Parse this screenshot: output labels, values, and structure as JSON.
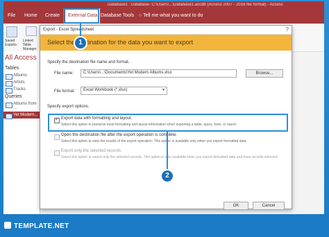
{
  "titlebar": {
    "text": "Database1 : Database- C:\\Users\\...\\Database1.accdb (Access 2007 - 2016 file format) - Access"
  },
  "ribbon": {
    "tabs": [
      "File",
      "Home",
      "Create",
      "External Data",
      "Database Tools"
    ],
    "tell_me": "Tell me what you want to do",
    "groups": [
      "Saved Exports",
      "Linked Table Manager"
    ]
  },
  "nav": {
    "header": "All Access",
    "tables_label": "Tables",
    "tables": [
      "Albums",
      "Artists",
      "Tracks"
    ],
    "queries_label": "Queries",
    "queries": [
      "Albums from ...",
      "Yet Modern..."
    ]
  },
  "dialog": {
    "title": "Export - Excel Spreadsheet",
    "banner": "Select the destination for the data you want to export",
    "spec_text": "Specify the destination file name and format.",
    "file_name_label": "File name:",
    "file_name_value": "C:\\Users\\...\\Documents\\Yet Modern Albums.xlsx",
    "browse": "Browse...",
    "file_format_label": "File format:",
    "file_format_value": "Excel Workbook (*.xlsx)",
    "options_head": "Specify export options.",
    "options": [
      {
        "label": "Export data with formatting and layout.",
        "desc": "Select this option to preserve most formatting and layout information when exporting a table, query, form, or report.",
        "checked": true,
        "disabled": false
      },
      {
        "label": "Open the destination file after the export operation is complete.",
        "desc": "Select this option to view the results of the export operation. This option is available only when you export formatted data.",
        "checked": false,
        "disabled": true
      },
      {
        "label": "Export only the selected records.",
        "desc": "Select this option to export only the selected records. This option is only available when you export formatted data and have records selected.",
        "checked": false,
        "disabled": true
      }
    ],
    "ok": "OK",
    "cancel": "Cancel"
  },
  "callouts": [
    "1",
    "2"
  ],
  "brand": "TEMPLATE.NET",
  "colors": {
    "access_red": "#a4373a",
    "banner": "#f3b43c",
    "highlight": "#2a8fd6",
    "bg": "#1b7bc6"
  }
}
